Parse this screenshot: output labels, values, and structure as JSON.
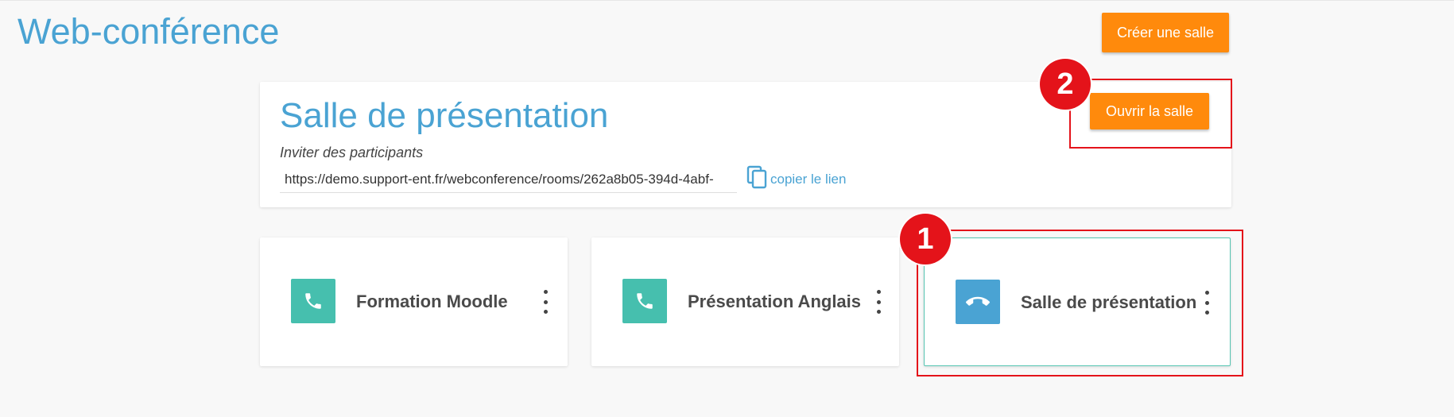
{
  "header": {
    "title": "Web-conférence",
    "create_button": "Créer une salle"
  },
  "room_panel": {
    "title": "Salle de présentation",
    "invite_label": "Inviter des participants",
    "invite_url": "https://demo.support-ent.fr/webconference/rooms/262a8b05-394d-4abf-",
    "copy_label": "copier le lien",
    "open_button": "Ouvrir la salle"
  },
  "rooms": [
    {
      "name": "Formation Moodle",
      "icon": "phone-icon",
      "color": "#46bfae",
      "selected": false
    },
    {
      "name": "Présentation Anglais",
      "icon": "phone-icon",
      "color": "#46bfae",
      "selected": false
    },
    {
      "name": "Salle de présentation",
      "icon": "phone-hangup-icon",
      "color": "#4aa3d3",
      "selected": true
    }
  ],
  "annotations": {
    "step_1": "1",
    "step_2": "2",
    "highlight_color": "#e4131a"
  },
  "colors": {
    "accent": "#4aa3d3",
    "button": "#ff8a0c",
    "tile_icon_green": "#46bfae"
  }
}
